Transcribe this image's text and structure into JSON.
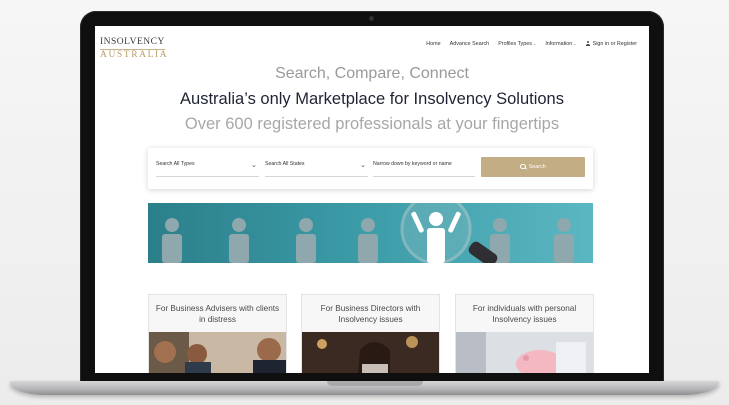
{
  "logo": {
    "line1": "INSOLVENCY",
    "line2": "AUSTRALIA"
  },
  "nav": {
    "home": "Home",
    "advance_search": "Advance Search",
    "profiles_types": "Profiles Types",
    "information": "Information",
    "sign_in_register": "Sign in or Register"
  },
  "hero": {
    "line1": "Search, Compare, Connect",
    "line2": "Australia’s only Marketplace for Insolvency Solutions",
    "line3": "Over 600 registered professionals at your fingertips"
  },
  "search": {
    "types": "Search All Types",
    "states": "Search All States",
    "keyword": "Narrow down by keyword or name",
    "button": "Search"
  },
  "cards": [
    {
      "title": "For Business Advisers with clients in distress"
    },
    {
      "title": "For Business Directors with Insolvency issues"
    },
    {
      "title": "For individuals with personal Insolvency issues"
    }
  ],
  "colors": {
    "accent": "#c3ad85",
    "banner": "#3a9aa6",
    "heading": "#1e2433"
  }
}
